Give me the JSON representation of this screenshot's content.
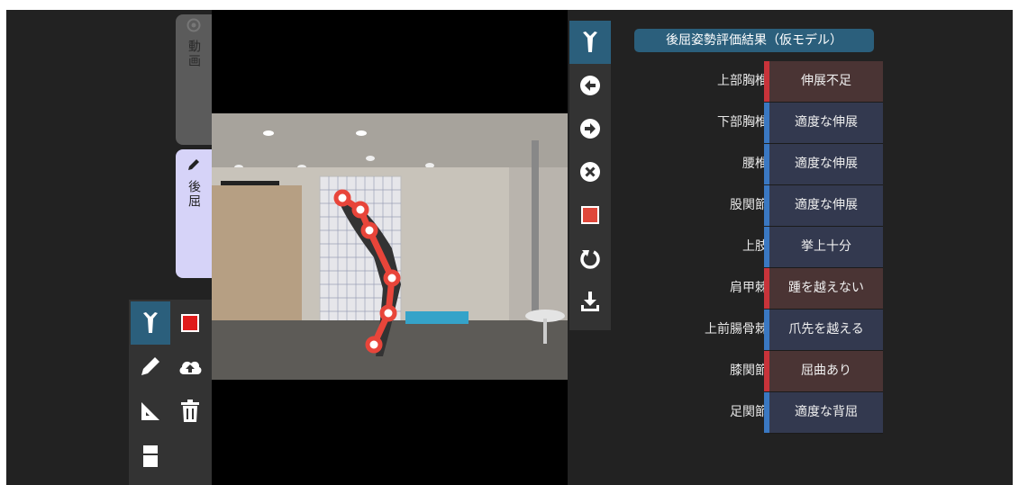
{
  "left_tabs": {
    "video_label": "動画",
    "back_label": "後屈"
  },
  "results": {
    "title": "後屈姿勢評価結果（仮モデル）",
    "rows": [
      {
        "label": "上部胸椎",
        "value": "伸展不足",
        "status": "bad"
      },
      {
        "label": "下部胸椎",
        "value": "適度な伸展",
        "status": "good"
      },
      {
        "label": "腰椎",
        "value": "適度な伸展",
        "status": "good"
      },
      {
        "label": "股関節",
        "value": "適度な伸展",
        "status": "good"
      },
      {
        "label": "上肢",
        "value": "挙上十分",
        "status": "good"
      },
      {
        "label": "肩甲棘",
        "value": "踵を越えない",
        "status": "bad"
      },
      {
        "label": "上前腸骨棘",
        "value": "爪先を越える",
        "status": "good"
      },
      {
        "label": "膝関節",
        "value": "屈曲あり",
        "status": "bad"
      },
      {
        "label": "足関節",
        "value": "適度な背屈",
        "status": "good"
      }
    ]
  },
  "colors": {
    "bad_bar": "#c8333a",
    "bad_bg": "#4a3434",
    "good_bar": "#3a78c2",
    "good_bg": "#33394f",
    "accent": "#2b5f7c",
    "keypoint": "#e8453a"
  },
  "left_tools": [
    "posture-icon",
    "stop-icon",
    "pencil-icon",
    "cloud-upload-icon",
    "ruler-icon",
    "trash-icon",
    "panel-icon"
  ],
  "right_tools": [
    "posture-icon",
    "arrow-left-icon",
    "arrow-right-icon",
    "close-icon",
    "stop-icon",
    "rotate-icon",
    "download-icon"
  ]
}
